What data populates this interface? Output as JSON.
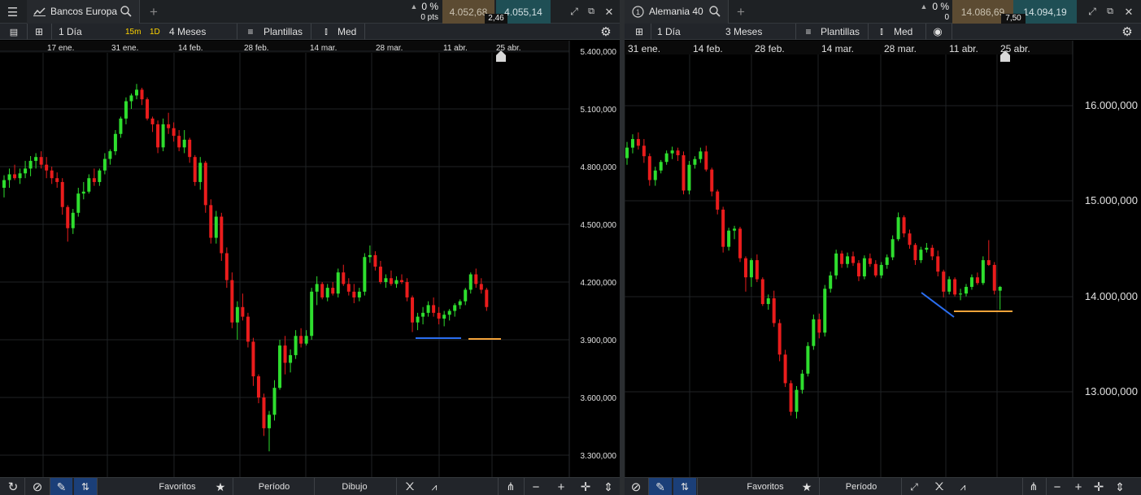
{
  "left": {
    "instrument": "Bancos Europa",
    "change_pct": "0 %",
    "change_pts": "0 pts",
    "bid": "4.052,68",
    "ask": "4.055,14",
    "spread": "2,46",
    "toolbar": {
      "interval": "1 Día",
      "q1": "15m",
      "q2": "1D",
      "period": "4 Meses",
      "templates": "Plantillas",
      "type": "Med"
    },
    "bottom": {
      "favorites": "Favoritos",
      "period": "Período",
      "drawing": "Dibujo"
    }
  },
  "right": {
    "instrument": "Alemania 40",
    "change_pct": "0 %",
    "change_pts": "0",
    "bid": "14.086,69",
    "ask": "14.094,19",
    "spread": "7,50",
    "toolbar": {
      "interval": "1 Día",
      "period": "3 Meses",
      "templates": "Plantillas",
      "type": "Med"
    },
    "bottom": {
      "favorites": "Favoritos",
      "period": "Período"
    }
  },
  "colors": {
    "up": "#2ede2e",
    "down": "#ea1c1c",
    "blue_line": "#2a6ef0",
    "orange_line": "#f2a33a",
    "grid": "#1f2225"
  },
  "chart_data": [
    {
      "type": "candlestick",
      "instrument": "Bancos Europa",
      "x_ticks": [
        "17 ene.",
        "31 ene.",
        "14 feb.",
        "28 feb.",
        "14 mar.",
        "28 mar.",
        "11 abr.",
        "25 abr."
      ],
      "y_ticks": [
        "5.400,000",
        "5.100,000",
        "4.800,000",
        "4.500,000",
        "4.200,000",
        "3.900,000",
        "3.600,000",
        "3.300,000"
      ],
      "ylim": [
        3200,
        5400
      ],
      "candles": [
        [
          4690,
          4755,
          4640,
          4730
        ],
        [
          4730,
          4790,
          4690,
          4760
        ],
        [
          4760,
          4810,
          4730,
          4740
        ],
        [
          4740,
          4790,
          4710,
          4765
        ],
        [
          4765,
          4830,
          4740,
          4790
        ],
        [
          4790,
          4855,
          4750,
          4830
        ],
        [
          4830,
          4870,
          4790,
          4850
        ],
        [
          4850,
          4880,
          4790,
          4810
        ],
        [
          4810,
          4850,
          4740,
          4780
        ],
        [
          4780,
          4800,
          4710,
          4740
        ],
        [
          4740,
          4770,
          4690,
          4720
        ],
        [
          4720,
          4740,
          4550,
          4590
        ],
        [
          4590,
          4600,
          4410,
          4480
        ],
        [
          4480,
          4580,
          4450,
          4560
        ],
        [
          4560,
          4690,
          4540,
          4660
        ],
        [
          4660,
          4720,
          4630,
          4670
        ],
        [
          4670,
          4760,
          4660,
          4740
        ],
        [
          4740,
          4790,
          4700,
          4720
        ],
        [
          4720,
          4790,
          4700,
          4780
        ],
        [
          4780,
          4870,
          4760,
          4840
        ],
        [
          4840,
          4890,
          4810,
          4880
        ],
        [
          4880,
          4990,
          4860,
          4970
        ],
        [
          4970,
          5060,
          4950,
          5050
        ],
        [
          5050,
          5160,
          5020,
          5140
        ],
        [
          5140,
          5180,
          5100,
          5170
        ],
        [
          5170,
          5230,
          5150,
          5200
        ],
        [
          5200,
          5210,
          5120,
          5150
        ],
        [
          5150,
          5160,
          5040,
          5050
        ],
        [
          5050,
          5060,
          4980,
          5020
        ],
        [
          5020,
          5040,
          4870,
          4900
        ],
        [
          4900,
          5050,
          4880,
          5020
        ],
        [
          5020,
          5080,
          4970,
          5000
        ],
        [
          5000,
          5030,
          4930,
          4960
        ],
        [
          4960,
          4990,
          4880,
          4900
        ],
        [
          4900,
          4990,
          4870,
          4940
        ],
        [
          4940,
          4950,
          4820,
          4850
        ],
        [
          4850,
          4860,
          4700,
          4720
        ],
        [
          4720,
          4850,
          4680,
          4820
        ],
        [
          4820,
          4830,
          4560,
          4600
        ],
        [
          4600,
          4630,
          4400,
          4430
        ],
        [
          4430,
          4570,
          4400,
          4540
        ],
        [
          4540,
          4560,
          4310,
          4350
        ],
        [
          4350,
          4380,
          4170,
          4210
        ],
        [
          4210,
          4250,
          3960,
          3990
        ],
        [
          3990,
          4100,
          3900,
          4070
        ],
        [
          4070,
          4140,
          4000,
          4020
        ],
        [
          4020,
          4040,
          3860,
          3890
        ],
        [
          3890,
          3910,
          3660,
          3710
        ],
        [
          3710,
          3720,
          3570,
          3600
        ],
        [
          3600,
          3620,
          3400,
          3440
        ],
        [
          3440,
          3530,
          3320,
          3510
        ],
        [
          3510,
          3690,
          3480,
          3650
        ],
        [
          3650,
          3900,
          3640,
          3870
        ],
        [
          3870,
          3920,
          3720,
          3780
        ],
        [
          3780,
          3850,
          3730,
          3820
        ],
        [
          3820,
          3950,
          3800,
          3920
        ],
        [
          3920,
          3960,
          3860,
          3880
        ],
        [
          3880,
          3950,
          3870,
          3920
        ],
        [
          3920,
          4170,
          3900,
          4150
        ],
        [
          4150,
          4230,
          4080,
          4190
        ],
        [
          4190,
          4200,
          4110,
          4120
        ],
        [
          4120,
          4190,
          4100,
          4170
        ],
        [
          4170,
          4200,
          4130,
          4140
        ],
        [
          4140,
          4270,
          4120,
          4250
        ],
        [
          4250,
          4290,
          4180,
          4190
        ],
        [
          4190,
          4220,
          4130,
          4150
        ],
        [
          4150,
          4190,
          4090,
          4120
        ],
        [
          4120,
          4170,
          4100,
          4150
        ],
        [
          4150,
          4350,
          4130,
          4330
        ],
        [
          4330,
          4390,
          4300,
          4340
        ],
        [
          4340,
          4360,
          4260,
          4280
        ],
        [
          4280,
          4310,
          4190,
          4200
        ],
        [
          4200,
          4240,
          4170,
          4220
        ],
        [
          4220,
          4260,
          4180,
          4190
        ],
        [
          4190,
          4230,
          4170,
          4210
        ],
        [
          4210,
          4240,
          4190,
          4200
        ],
        [
          4200,
          4220,
          4100,
          4120
        ],
        [
          4120,
          4130,
          3940,
          3990
        ],
        [
          3990,
          4040,
          3950,
          4020
        ],
        [
          4020,
          4070,
          3980,
          4040
        ],
        [
          4040,
          4100,
          4020,
          4080
        ],
        [
          4080,
          4120,
          4020,
          4040
        ],
        [
          4040,
          4070,
          3980,
          4010
        ],
        [
          4010,
          4050,
          3970,
          4030
        ],
        [
          4030,
          4060,
          4000,
          4050
        ],
        [
          4050,
          4090,
          4020,
          4080
        ],
        [
          4080,
          4110,
          4060,
          4100
        ],
        [
          4100,
          4170,
          4080,
          4160
        ],
        [
          4160,
          4250,
          4140,
          4240
        ],
        [
          4240,
          4270,
          4170,
          4190
        ],
        [
          4190,
          4220,
          4140,
          4160
        ],
        [
          4160,
          4170,
          4050,
          4070
        ]
      ],
      "annotations": [
        {
          "color": "blue",
          "from": [
            "2 abr.",
            3930
          ],
          "to": [
            "13 abr.",
            3930
          ]
        },
        {
          "color": "orange",
          "from": [
            "14 abr.",
            3920
          ],
          "to": [
            "22 abr.",
            3920
          ]
        }
      ]
    },
    {
      "type": "candlestick",
      "instrument": "Alemania 40",
      "x_ticks": [
        "31 ene.",
        "14 feb.",
        "28 feb.",
        "14 mar.",
        "28 mar.",
        "11 abr.",
        "25 abr."
      ],
      "y_ticks": [
        "16.000,000",
        "15.000,000",
        "14.000,000",
        "13.000,000"
      ],
      "ylim": [
        12200,
        16600
      ],
      "candles": [
        [
          15450,
          15620,
          15380,
          15560
        ],
        [
          15560,
          15700,
          15500,
          15650
        ],
        [
          15650,
          15720,
          15540,
          15580
        ],
        [
          15580,
          15650,
          15400,
          15470
        ],
        [
          15470,
          15500,
          15160,
          15220
        ],
        [
          15220,
          15360,
          15160,
          15320
        ],
        [
          15320,
          15430,
          15290,
          15410
        ],
        [
          15410,
          15530,
          15380,
          15500
        ],
        [
          15500,
          15570,
          15440,
          15530
        ],
        [
          15530,
          15560,
          15420,
          15480
        ],
        [
          15480,
          15520,
          15070,
          15110
        ],
        [
          15110,
          15420,
          15070,
          15380
        ],
        [
          15380,
          15470,
          15340,
          15440
        ],
        [
          15440,
          15560,
          15400,
          15520
        ],
        [
          15520,
          15580,
          15310,
          15330
        ],
        [
          15330,
          15350,
          15050,
          15100
        ],
        [
          15100,
          15120,
          14860,
          14910
        ],
        [
          14910,
          14940,
          14460,
          14520
        ],
        [
          14520,
          14720,
          14480,
          14690
        ],
        [
          14690,
          14740,
          14600,
          14710
        ],
        [
          14710,
          14730,
          14360,
          14400
        ],
        [
          14400,
          14420,
          14050,
          14200
        ],
        [
          14200,
          14400,
          14100,
          14380
        ],
        [
          14380,
          14440,
          14150,
          14180
        ],
        [
          14180,
          14200,
          13900,
          13920
        ],
        [
          13920,
          14020,
          13860,
          13980
        ],
        [
          13980,
          14060,
          13680,
          13720
        ],
        [
          13720,
          13760,
          13320,
          13390
        ],
        [
          13390,
          13440,
          13050,
          13090
        ],
        [
          13090,
          13120,
          12750,
          12790
        ],
        [
          12790,
          13060,
          12720,
          13020
        ],
        [
          13020,
          13230,
          12980,
          13190
        ],
        [
          13190,
          13520,
          13160,
          13480
        ],
        [
          13480,
          13810,
          13440,
          13760
        ],
        [
          13760,
          13820,
          13560,
          13620
        ],
        [
          13620,
          14120,
          13580,
          14080
        ],
        [
          14080,
          14260,
          14040,
          14220
        ],
        [
          14220,
          14490,
          14180,
          14450
        ],
        [
          14450,
          14480,
          14300,
          14340
        ],
        [
          14340,
          14460,
          14300,
          14420
        ],
        [
          14420,
          14470,
          14320,
          14350
        ],
        [
          14350,
          14380,
          14160,
          14210
        ],
        [
          14210,
          14430,
          14180,
          14400
        ],
        [
          14400,
          14450,
          14310,
          14340
        ],
        [
          14340,
          14380,
          14200,
          14220
        ],
        [
          14220,
          14360,
          14190,
          14330
        ],
        [
          14330,
          14440,
          14290,
          14410
        ],
        [
          14410,
          14640,
          14380,
          14600
        ],
        [
          14600,
          14880,
          14580,
          14830
        ],
        [
          14830,
          14850,
          14620,
          14660
        ],
        [
          14660,
          14700,
          14500,
          14540
        ],
        [
          14540,
          14560,
          14330,
          14380
        ],
        [
          14380,
          14520,
          14350,
          14490
        ],
        [
          14490,
          14560,
          14460,
          14510
        ],
        [
          14510,
          14540,
          14380,
          14420
        ],
        [
          14420,
          14480,
          14210,
          14260
        ],
        [
          14260,
          14280,
          13990,
          14050
        ],
        [
          14050,
          14210,
          14020,
          14180
        ],
        [
          14180,
          14200,
          14000,
          14020
        ],
        [
          14020,
          14080,
          13960,
          14030
        ],
        [
          14030,
          14130,
          14000,
          14100
        ],
        [
          14100,
          14230,
          14070,
          14200
        ],
        [
          14200,
          14250,
          14120,
          14140
        ],
        [
          14140,
          14420,
          14120,
          14380
        ],
        [
          14380,
          14590,
          14320,
          14330
        ],
        [
          14330,
          14360,
          14020,
          14060
        ],
        [
          14060,
          14110,
          13860,
          14100
        ]
      ],
      "annotations": [
        {
          "color": "blue",
          "from": [
            "6 abr.",
            14050
          ],
          "to": [
            "12 abr.",
            13820
          ]
        },
        {
          "color": "orange",
          "from": [
            "12 abr.",
            13850
          ],
          "to": [
            "20 abr.",
            13850
          ]
        }
      ]
    }
  ]
}
